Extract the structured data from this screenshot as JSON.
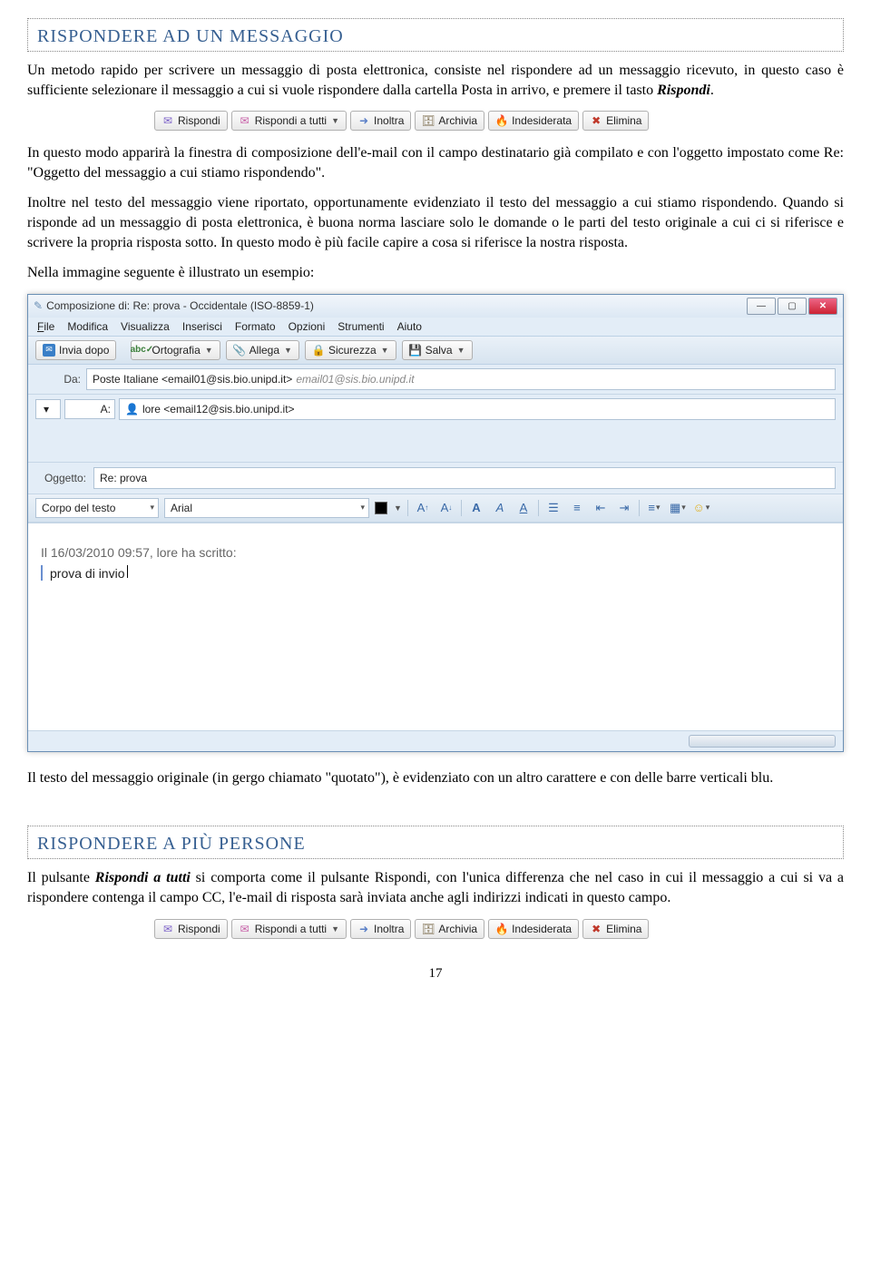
{
  "section1": {
    "heading": "RISPONDERE AD UN MESSAGGIO",
    "para1a": "Un metodo rapido per scrivere un messaggio di posta elettronica, consiste nel rispondere ad un messaggio ricevuto, in questo caso è sufficiente selezionare il messaggio a cui si vuole rispondere dalla cartella Posta in arrivo, e premere il tasto ",
    "para1_bold": "Rispondi",
    "para1b": ".",
    "para2": "In questo modo apparirà la finestra di composizione dell'e-mail con il campo destinatario già compilato e con l'oggetto impostato come Re: \"Oggetto del messaggio a cui stiamo rispondendo\".",
    "para3": "Inoltre nel testo del messaggio viene riportato, opportunamente evidenziato il testo del messaggio a cui stiamo rispondendo. Quando si risponde ad un messaggio di posta elettronica, è buona norma lasciare solo le domande o le parti del testo originale a cui ci si riferisce e scrivere la propria risposta sotto. In questo modo è più facile capire a cosa si riferisce la nostra risposta.",
    "para4": "Nella immagine seguente è illustrato un esempio:",
    "para5": "Il testo del messaggio originale (in gergo chiamato \"quotato\"), è evidenziato con un altro carattere e con delle barre verticali blu."
  },
  "section2": {
    "heading": "RISPONDERE A PIÙ PERSONE",
    "para1a": "Il pulsante ",
    "para1_bold": "Rispondi a tutti",
    "para1b": " si comporta come il pulsante Rispondi, con l'unica differenza che nel caso in cui il messaggio a cui si va a rispondere contenga il campo CC, l'e-mail di risposta sarà inviata anche agli indirizzi indicati in questo campo."
  },
  "toolbar": {
    "reply": "Rispondi",
    "reply_all": "Rispondi a tutti",
    "forward": "Inoltra",
    "archive": "Archivia",
    "junk": "Indesiderata",
    "delete": "Elimina"
  },
  "compose": {
    "title": "Composizione di: Re: prova - Occidentale (ISO-8859-1)",
    "menus": {
      "file": "File",
      "edit": "Modifica",
      "view": "Visualizza",
      "insert": "Inserisci",
      "format": "Formato",
      "options": "Opzioni",
      "tools": "Strumenti",
      "help": "Aiuto"
    },
    "mainbar": {
      "send": "Invia dopo",
      "spell": "Ortografia",
      "attach": "Allega",
      "security": "Sicurezza",
      "save": "Salva"
    },
    "from_label": "Da:",
    "from_value": "Poste Italiane <email01@sis.bio.unipd.it>",
    "from_dim": "email01@sis.bio.unipd.it",
    "to_label": "A:",
    "to_value": "lore <email12@sis.bio.unipd.it>",
    "subject_label": "Oggetto:",
    "subject_value": "Re: prova",
    "textstyle": "Corpo del testo",
    "font": "Arial",
    "quote_head": "Il 16/03/2010 09:57, lore ha scritto:",
    "quote_body": "prova di invio"
  },
  "page_number": "17"
}
